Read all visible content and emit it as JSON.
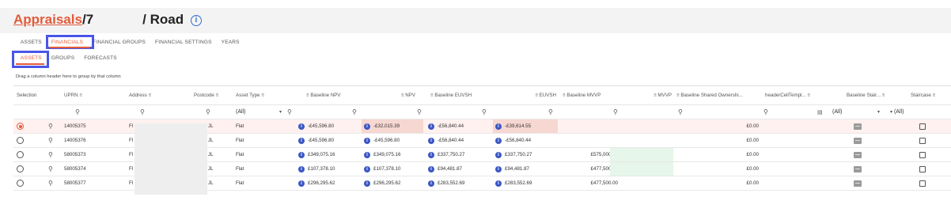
{
  "title": {
    "breadcrumb": "Appraisals",
    "separator": "/",
    "prefix": "7",
    "suffix": "/ Road",
    "info_icon": "info-circle-icon"
  },
  "tabs_primary": [
    "ASSETS",
    "FINANCIALS",
    "FINANCIAL GROUPS",
    "FINANCIAL SETTINGS",
    "YEARS"
  ],
  "tabs_secondary": [
    "ASSETS",
    "GROUPS",
    "FORECASTS"
  ],
  "group_hint": "Drag a column header here to group by that column",
  "columns": {
    "selection": "Selection",
    "uprn": "UPRN",
    "address": "Address",
    "postcode": "Postcode",
    "asset_type": "Asset Type",
    "baseline_npv": "Baseline NPV",
    "npv": "NPV",
    "baseline_euvsh": "Baseline EUVSH",
    "euvsh": "EUVSH",
    "baseline_mvvp": "Baseline MVVP",
    "mvvp": "MVVP",
    "baseline_shared": "Baseline Shared Ownershi...",
    "header_template": "headerCellTempl...",
    "baseline_stair": "Baseline Stair...",
    "staircase": "Staircase"
  },
  "filters": {
    "asset_type": "(All)",
    "baseline_stair": "(All)",
    "staircase": "(All)"
  },
  "rows": [
    {
      "selected": true,
      "uprn": "14005375",
      "address": "Fl",
      "postcode": "JL",
      "type": "Flat",
      "bnpv": "-£45,596.80",
      "npv": "-£32,015.39",
      "beuvsh": "-£56,840.44",
      "euvsh": "-£39,614.55",
      "bmvvp": "",
      "shared": "£0.00"
    },
    {
      "selected": false,
      "uprn": "14005376",
      "address": "Fl",
      "postcode": "JL",
      "type": "Flat",
      "bnpv": "-£45,596.80",
      "npv": "-£45,596.80",
      "beuvsh": "-£56,840.44",
      "euvsh": "-£56,840.44",
      "bmvvp": "",
      "shared": "£0.00"
    },
    {
      "selected": false,
      "uprn": "58005373",
      "address": "Fl",
      "postcode": "JL",
      "type": "Flat",
      "bnpv": "£349,075.16",
      "npv": "£349,075.16",
      "beuvsh": "£337,750.27",
      "euvsh": "£337,750.27",
      "bmvvp": "£575,000.00",
      "shared": "£0.00"
    },
    {
      "selected": false,
      "uprn": "58005374",
      "address": "Fl",
      "postcode": "JL",
      "type": "Flat",
      "bnpv": "£107,378.10",
      "npv": "£107,378.10",
      "beuvsh": "£94,481.87",
      "euvsh": "£94,481.87",
      "bmvvp": "£477,500.00",
      "shared": "£0.00"
    },
    {
      "selected": false,
      "uprn": "58005377",
      "address": "Fl",
      "postcode": "JL",
      "type": "Flat",
      "bnpv": "£296,295.62",
      "npv": "£296,295.62",
      "beuvsh": "£283,552.69",
      "euvsh": "£283,552.69",
      "bmvvp": "£477,500.00",
      "shared": "£0.00"
    }
  ],
  "colors": {
    "accent": "#e35b3a",
    "highlight_box": "#4a56e6",
    "info_button": "#3b57c4",
    "selected_row": "#fff1ef",
    "changed_cell": "#f7d7d1",
    "mvvp_cell": "#e6f6ea"
  }
}
